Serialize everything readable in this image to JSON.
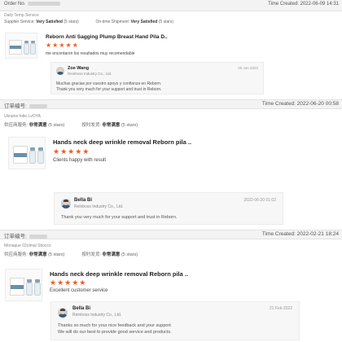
{
  "orders": [
    {
      "header_left": "Order No.",
      "header_right": "Time Created: 2022-06-09 14:31",
      "meta": "Daily Temp Service",
      "satisfaction": [
        {
          "label": "Supplier Service:",
          "value": "Very Satisfied",
          "count": "(5 stars)"
        },
        {
          "label": "On-time Shipment:",
          "value": "Very Satisfied",
          "count": "(5 stars)"
        }
      ],
      "product_title": "Reborn Anti Sagging Plump Breast Hand Pila D..",
      "stars": "★★★★★",
      "review": "me encontaron los resultados muy recomendable",
      "reply": {
        "name": "Zoe Wang",
        "company": "Reinboss Industry Co., Ltd.",
        "time": "25 Jun 2022",
        "lines": [
          "Muchas gracias por vuestro apoyo y confianza en Reborn.",
          "Thank you very much for your support and trust in Reborn."
        ]
      }
    },
    {
      "header_left": "订单编号:",
      "header_right": "Time Created: 2022-06-20 00:58",
      "meta": "Ukraine fotle.LvOYA",
      "satisfaction": [
        {
          "label": "供应商服务:",
          "value": "非常满意",
          "count": "(5 stars)"
        },
        {
          "label": "按时发货:",
          "value": "非常满意",
          "count": "(5 stars)"
        }
      ],
      "product_title": "Hands neck deep wrinkle removal Reborn pila ..",
      "stars": "★★★★★",
      "review": "Clients happy with result",
      "reply": {
        "name": "Bella Bi",
        "company": "Reinboss Industry Co., Ltd.",
        "time": "2022-06-20 01:02",
        "lines": [
          "Thank you very much for your support and trust in Reborn."
        ]
      }
    },
    {
      "header_left": "订单编号:",
      "header_right": "Time Created: 2022-02-21 18:24",
      "meta": "Monaque 02olmal Sboccs",
      "satisfaction": [
        {
          "label": "供应商服务:",
          "value": "非常满意",
          "count": "(5 stars)"
        },
        {
          "label": "按时发货:",
          "value": "非常满意",
          "count": "(5 stars)"
        }
      ],
      "product_title": "Hands neck deep wrinkle removal Reborn pila ..",
      "stars": "★★★★★",
      "review": "Excellent customer service",
      "reply": {
        "name": "Bella Bi",
        "company": "Reinboss Industry Co., Ltd.",
        "time": "21 Feb 2022",
        "lines": [
          "Thanks so much for your nice feedback and your support",
          "We will do our best to provide good service and products."
        ]
      }
    }
  ],
  "colors": {
    "star": "#f15a24",
    "header_bg": "#f3f3f3",
    "reply_bg": "#f7f7f7"
  }
}
